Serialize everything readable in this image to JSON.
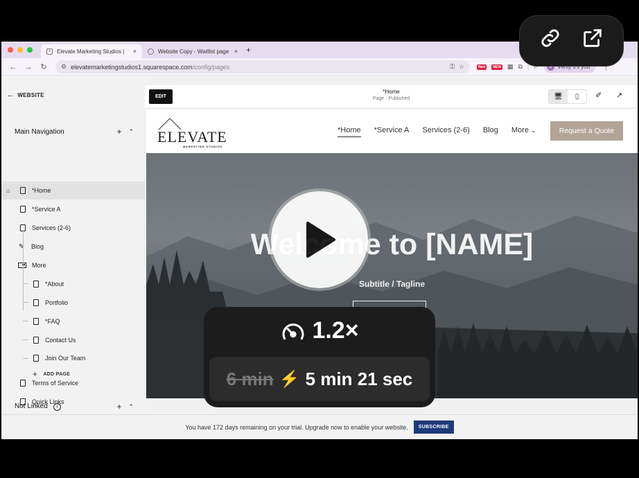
{
  "browser": {
    "tabs": [
      {
        "label": "Elevate Marketing Studios |",
        "fav": "sq-icon"
      },
      {
        "label": "Website Copy - Waitlist page",
        "fav": "globe-icon"
      }
    ],
    "tab_close": "×",
    "new_tab": "+",
    "url_main": "elevatemarketingstudios1.squarespace.com",
    "url_path": "/config/pages",
    "badge_new1": "New",
    "badge_new2": "NEW",
    "verify_label": "Verify it's you",
    "verify_initial": "e"
  },
  "sidebar": {
    "back_label": "WEBSITE",
    "main_nav_title": "Main Navigation",
    "main_items": [
      {
        "label": "*Home"
      },
      {
        "label": "*Service A"
      },
      {
        "label": "Services (2-6)"
      },
      {
        "label": "Blog"
      },
      {
        "label": "More"
      }
    ],
    "more_items": [
      {
        "label": "*About"
      },
      {
        "label": "Portfolio"
      },
      {
        "label": "*FAQ"
      },
      {
        "label": "Contact Us"
      },
      {
        "label": "Join Our Team"
      }
    ],
    "add_page": "ADD PAGE",
    "not_linked_title": "Not Linked",
    "not_linked_items": [
      {
        "label": "Terms of Service"
      },
      {
        "label": "Quick Links"
      }
    ]
  },
  "editor": {
    "edit_label": "EDIT",
    "page_title": "*Home",
    "page_status": "Page · Published"
  },
  "site": {
    "logo_word": "ELEVATE",
    "logo_tag": "MARKETING STUDIOS",
    "nav": [
      "*Home",
      "*Service A",
      "Services (2-6)",
      "Blog",
      "More"
    ],
    "quote_button": "Request a Quote",
    "hero_title": "Welcome to [NAME]",
    "hero_subtitle": "Subtitle / Tagline"
  },
  "trial": {
    "message": "You have 172 days remaining on your trial. Upgrade now to enable your website.",
    "button": "SUBSCRIBE"
  },
  "overlay": {
    "speed": "1.2×",
    "old_time": "6 min",
    "new_time": "5 min 21 sec"
  },
  "colors": {
    "tabbar": "#e6dcef",
    "quote_button": "#b3a496",
    "subscribe": "#1f3a7a",
    "bolt": "#f5b400"
  }
}
